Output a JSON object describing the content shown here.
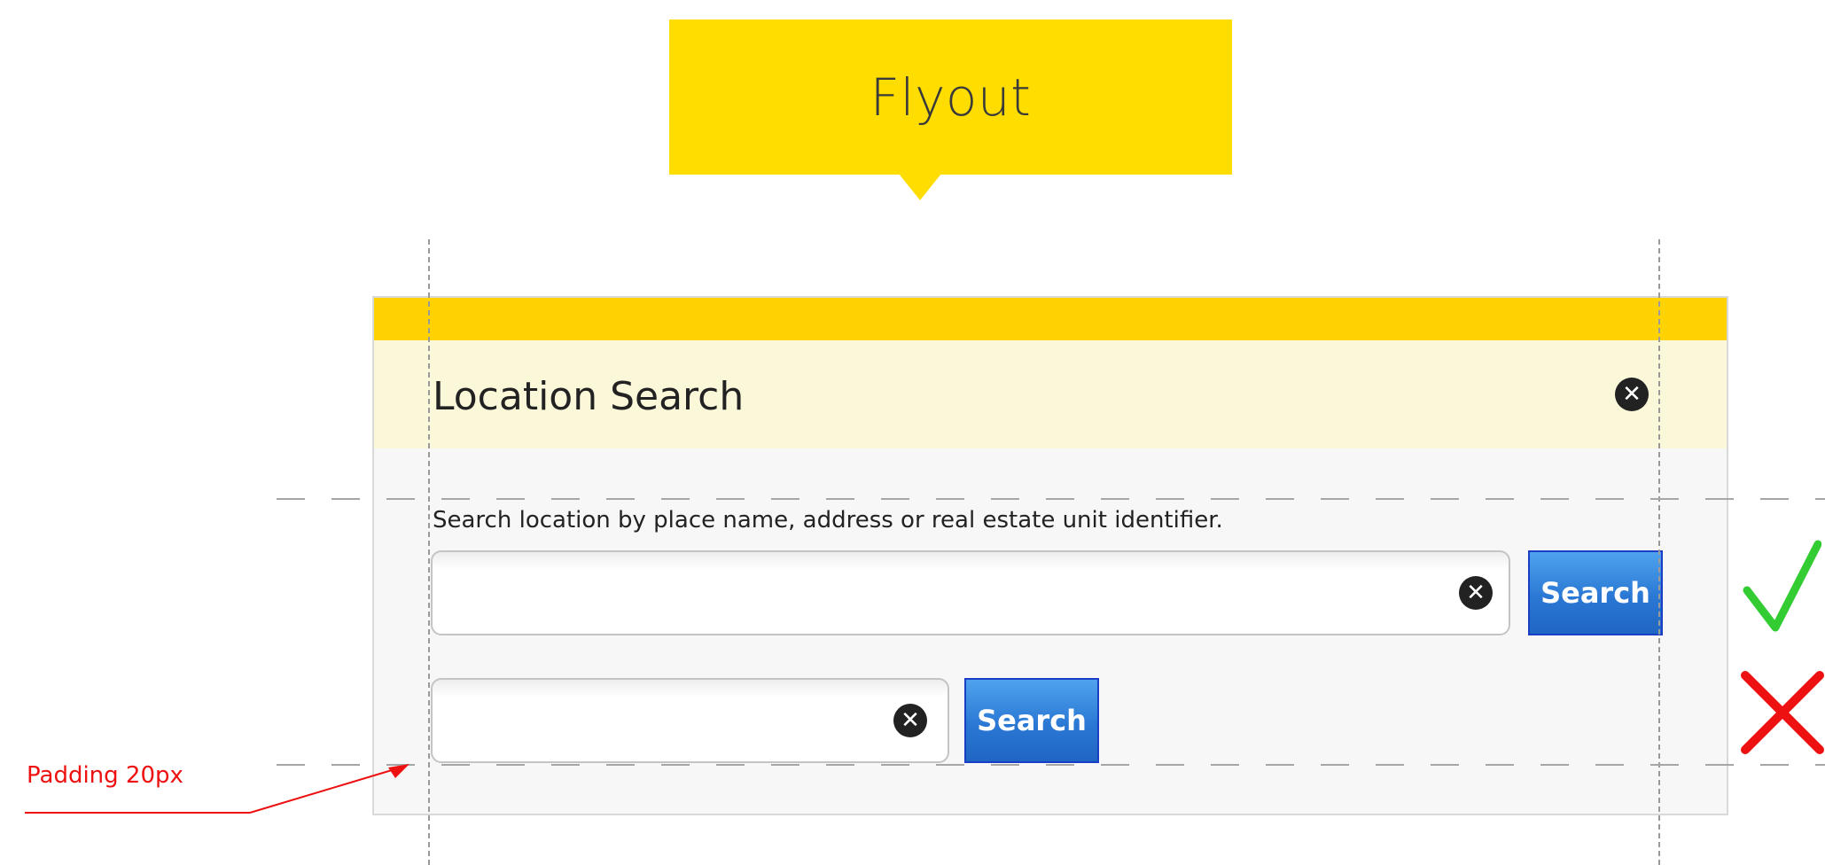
{
  "callout": {
    "title": "Flyout"
  },
  "flyout": {
    "title": "Location Search",
    "description": "Search location by place name, address or real estate unit identifier.",
    "search_button_label": "Search",
    "search_value": "",
    "close_glyph": "✕"
  },
  "annotation": {
    "label": "Padding 20px"
  },
  "colors": {
    "callout_yellow": "#ffdd00",
    "flyout_topbar": "#ffd200",
    "flyout_header_bg": "#fbf7d9",
    "button_blue": "#2a78d4",
    "correct_green": "#33cc33",
    "wrong_red": "#ee1111"
  },
  "icons": {
    "header_close": "close-circle-icon",
    "clear_input": "clear-circle-icon",
    "correct": "checkmark-icon",
    "wrong": "cross-icon",
    "annotation": "arrow-icon"
  }
}
